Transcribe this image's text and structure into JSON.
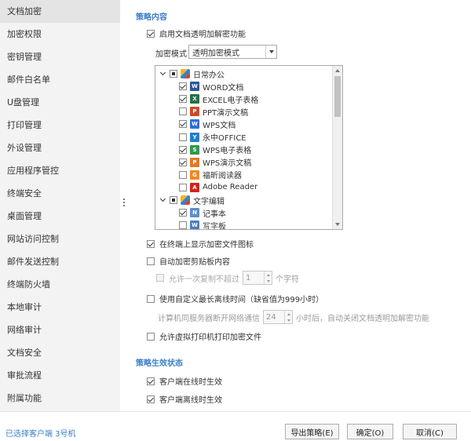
{
  "sidebar": {
    "items": [
      {
        "label": "文档加密",
        "active": true
      },
      {
        "label": "加密权限"
      },
      {
        "label": "密钥管理"
      },
      {
        "label": "邮件白名单"
      },
      {
        "label": "U盘管理"
      },
      {
        "label": "打印管理"
      },
      {
        "label": "外设管理"
      },
      {
        "label": "应用程序管控"
      },
      {
        "label": "终端安全"
      },
      {
        "label": "桌面管理"
      },
      {
        "label": "网站访问控制"
      },
      {
        "label": "邮件发送控制"
      },
      {
        "label": "终端防火墙"
      },
      {
        "label": "本地审计"
      },
      {
        "label": "网络审计"
      },
      {
        "label": "文档安全"
      },
      {
        "label": "审批流程"
      },
      {
        "label": "附属功能"
      }
    ]
  },
  "policy": {
    "section_title": "策略内容",
    "enable_label": "启用文档透明加解密功能",
    "enable_checked": true,
    "mode_label": "加密模式",
    "mode_value": "透明加密模式",
    "tree": [
      {
        "label": "日常办公",
        "level": 0,
        "state": "partial",
        "expanded": true,
        "icon": "office-group-icon"
      },
      {
        "label": "WORD文档",
        "level": 1,
        "checked": true,
        "icon": "word-icon",
        "icon_color": "#2b579a",
        "icon_text": "W"
      },
      {
        "label": "EXCEL电子表格",
        "level": 1,
        "checked": true,
        "icon": "excel-icon",
        "icon_color": "#217346",
        "icon_text": "X"
      },
      {
        "label": "PPT演示文稿",
        "level": 1,
        "checked": false,
        "icon": "ppt-icon",
        "icon_color": "#d24726",
        "icon_text": "P"
      },
      {
        "label": "WPS文档",
        "level": 1,
        "checked": true,
        "icon": "wps-writer-icon",
        "icon_color": "#2f6fd8",
        "icon_text": "W"
      },
      {
        "label": "永中OFFICE",
        "level": 1,
        "checked": false,
        "icon": "yozo-office-icon",
        "icon_color": "#1f7fd0",
        "icon_text": "Y"
      },
      {
        "label": "WPS电子表格",
        "level": 1,
        "checked": true,
        "icon": "wps-sheet-icon",
        "icon_color": "#2b9b4a",
        "icon_text": "S"
      },
      {
        "label": "WPS演示文稿",
        "level": 1,
        "checked": true,
        "icon": "wps-presentation-icon",
        "icon_color": "#e8771e",
        "icon_text": "P"
      },
      {
        "label": "福昕阅读器",
        "level": 1,
        "checked": false,
        "icon": "foxit-reader-icon",
        "icon_color": "#f08a1c",
        "icon_text": "G"
      },
      {
        "label": "Adobe Reader",
        "level": 1,
        "checked": false,
        "icon": "adobe-reader-icon",
        "icon_color": "#d6221a",
        "icon_text": "A"
      },
      {
        "label": "文字编辑",
        "level": 0,
        "state": "partial",
        "expanded": true,
        "icon": "text-edit-group-icon"
      },
      {
        "label": "记事本",
        "level": 1,
        "checked": true,
        "icon": "notepad-icon",
        "icon_color": "#5b8fc9",
        "icon_text": "N"
      },
      {
        "label": "写字板",
        "level": 1,
        "checked": false,
        "icon": "wordpad-icon",
        "icon_color": "#4a7fbf",
        "icon_text": "W"
      }
    ],
    "show_icon_label": "在终端上显示加密文件图标",
    "show_icon_checked": true,
    "auto_clipboard_label": "自动加密剪贴板内容",
    "auto_clipboard_checked": false,
    "copy_limit_prefix": "允许一次复制不超过",
    "copy_limit_value": "1",
    "copy_limit_suffix": "个字符",
    "offline_label": "使用自定义最长离线时间（缺省值为999小时）",
    "offline_checked": false,
    "offline_prefix": "计算机同服务器断开网络通信",
    "offline_value": "24",
    "offline_suffix": "小时后，自动关闭文档透明加解密功能",
    "virtual_printer_label": "允许虚拟打印机打印加密文件",
    "virtual_printer_checked": false
  },
  "effective": {
    "section_title": "策略生效状态",
    "online_label": "客户端在线时生效",
    "online_checked": true,
    "offline_label": "客户端离线时生效",
    "offline_checked": true
  },
  "footer": {
    "client_label": "已选择客户端 3号机",
    "export_label": "导出策略(E)",
    "ok_label": "确定(O)",
    "cancel_label": "取消(C)"
  },
  "colors": {
    "accent": "#3a7fc8"
  }
}
